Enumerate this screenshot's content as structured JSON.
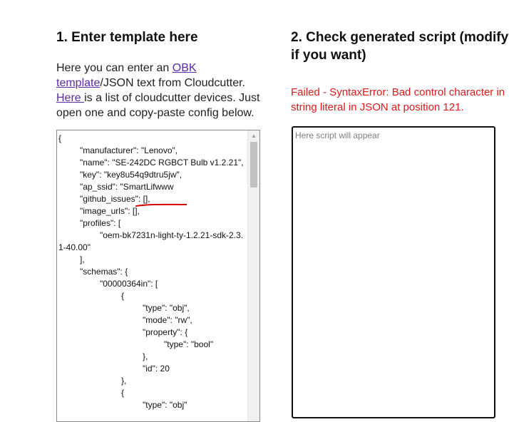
{
  "left": {
    "heading": "1. Enter template here",
    "intro_text1": "Here you can enter an ",
    "intro_link1_line1": "OBK",
    "intro_link1_line2": "template",
    "intro_text2": "/JSON text from Cloudcutter.",
    "intro_link2": "Here ",
    "intro_text3": "is a list of cloudcutter devices. Just open one and copy-paste config below."
  },
  "template": {
    "lines": [
      "{",
      "\"manufacturer\": \"Lenovo\",",
      "\"name\": \"SE-242DC RGBCT Bulb v1.2.21\",",
      "\"key\": \"key8u54q9dtru5jw\",",
      "\"ap_ssid\": \"SmartLifwww",
      "\"github_issues\": [],",
      "\"image_urls\": [],",
      "\"profiles\": [",
      "\"oem-bk7231n-light-ty-1.2.21-sdk-2.3.1-40.00\"",
      "],",
      "\"schemas\": {",
      "\"00000364in\": [",
      "{",
      "\"type\": \"obj\",",
      "\"mode\": \"rw\",",
      "\"property\": {",
      "\"type\": \"bool\"",
      "},",
      "\"id\": 20",
      "},",
      "{",
      "\"type\": \"obj\""
    ]
  },
  "right": {
    "heading": "2. Check generated script (modify if you want)",
    "error": "Failed - SyntaxError: Bad control character in string literal in JSON at position 121.",
    "script_placeholder": "Here script will appear"
  }
}
